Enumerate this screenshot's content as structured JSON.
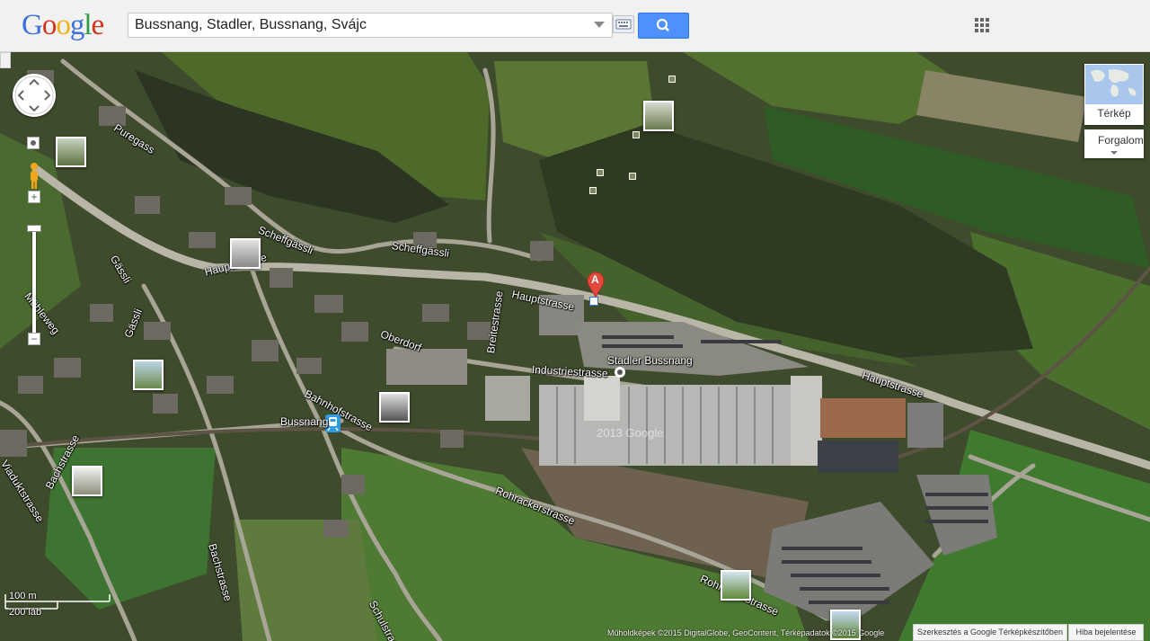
{
  "header": {
    "logo": [
      "G",
      "o",
      "o",
      "g",
      "l",
      "e"
    ],
    "logo_colors": [
      "#3b6fd9",
      "#d6331f",
      "#f0b418",
      "#3b6fd9",
      "#2e9a46",
      "#d6331f"
    ],
    "search": {
      "value": "Bussnang, Stadler, Bussnang, Svájc"
    },
    "icons": {
      "keyboard": "keyboard-icon",
      "search": "search-icon",
      "apps": "apps-grid-icon",
      "dropdown": "chevron-down-icon"
    }
  },
  "map": {
    "street_labels": {
      "puregass": "Puregass",
      "scheffgassli_a": "Scheffgässli",
      "scheffgassli_b": "Scheffgässli",
      "hauptstrasse_a": "Hauptstrasse",
      "hauptstrasse_b": "Hauptstrasse",
      "hauptstrasse_c": "Hauptstrasse",
      "gassli_a": "Gässli",
      "gassli_b": "Gässli",
      "muhleweg": "Mühleweg",
      "oberdorf": "Oberdorf",
      "breitestrasse": "Breitestrasse",
      "industriestrasse": "Industriestrasse",
      "bahnhofstrasse": "Bahnhofstrasse",
      "viaduktstrasse": "Viaduktstrasse",
      "bachstrasse_a": "Bachstrasse",
      "bachstrasse_b": "Bachstrasse",
      "rohrackerstrasse_a": "Rohrackerstrasse",
      "rohrackerstrasse_b": "Rohrackerstrasse",
      "schulstrasse": "Schulstrasse"
    },
    "poi": {
      "stadler": "Stadler Bussnang",
      "station": "Bussnang"
    },
    "marker": {
      "letter": "A",
      "color": "#e0493b"
    },
    "satellite_watermark": "2013 Google"
  },
  "controls": {
    "map_type_label": "Térkép",
    "traffic_label": "Forgalom",
    "zoom_in": "+",
    "zoom_out": "−"
  },
  "scale": {
    "metric": "100 m",
    "imperial": "200 láb"
  },
  "footer": {
    "attribution": "Műholdképek ©2015 DigitalGlobe, GeoContent, Térképadatok ©2015 Google",
    "edit_link": "Szerkesztés a Google Térképkészítőben",
    "report_link": "Hiba bejelentése"
  }
}
